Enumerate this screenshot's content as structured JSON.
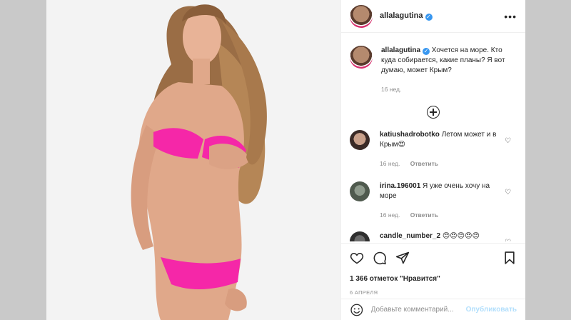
{
  "author": {
    "username": "allalagutina",
    "verified_mark": "✓"
  },
  "header": {
    "more_label": "•••"
  },
  "caption": {
    "username": "allalagutina",
    "text": "Хочется на море. Кто куда собирается, какие планы? Я вот думаю, может Крым?",
    "time": "16 нед."
  },
  "comments": [
    {
      "username": "katiushadrobotko",
      "text": "Летом может и в Крым😍",
      "time": "16 нед.",
      "reply": "Ответить"
    },
    {
      "username": "irina.196001",
      "text": "Я уже очень хочу на море",
      "time": "16 нед.",
      "reply": "Ответить"
    },
    {
      "username": "candle_number_2",
      "text": "😍😍😍😍😍",
      "time": "",
      "reply": ""
    }
  ],
  "likes": "1 366 отметок \"Нравится\"",
  "date": "6 АПРЕЛЯ",
  "add_comment": {
    "placeholder": "Добавьте комментарий...",
    "post_label": "Опубликовать"
  },
  "icons": {
    "more": "more-horizontal-icon",
    "load": "plus-circle-icon",
    "like": "heart-icon",
    "comment": "comment-bubble-icon",
    "share": "paper-plane-icon",
    "save": "bookmark-icon",
    "emoji": "emoji-smile-icon"
  },
  "colors": {
    "accent": "#3897f0",
    "bikini": "#f527a8",
    "post_disabled": "#b2dffc"
  }
}
